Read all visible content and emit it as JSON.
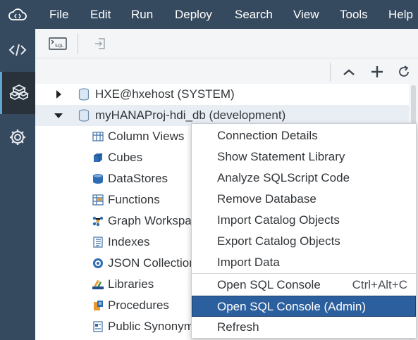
{
  "menubar": {
    "items": [
      {
        "label": "File"
      },
      {
        "label": "Edit"
      },
      {
        "label": "Run"
      },
      {
        "label": "Deploy"
      },
      {
        "label": "Search"
      },
      {
        "label": "View"
      },
      {
        "label": "Tools"
      },
      {
        "label": "Help"
      }
    ]
  },
  "toolbar": {
    "sql_button_glyph": "SQL"
  },
  "tree": {
    "nodes": [
      {
        "label": "HXE@hxehost (SYSTEM)",
        "icon": "database-icon",
        "expanded": false
      },
      {
        "label": "myHANAProj-hdi_db (development)",
        "icon": "database-icon",
        "expanded": true
      },
      {
        "label": "Column Views",
        "icon": "column-view-icon"
      },
      {
        "label": "Cubes",
        "icon": "cube-icon"
      },
      {
        "label": "DataStores",
        "icon": "datastore-icon"
      },
      {
        "label": "Functions",
        "icon": "function-icon"
      },
      {
        "label": "Graph Workspaces",
        "icon": "graph-icon"
      },
      {
        "label": "Indexes",
        "icon": "index-icon"
      },
      {
        "label": "JSON Collections",
        "icon": "json-icon"
      },
      {
        "label": "Libraries",
        "icon": "library-icon"
      },
      {
        "label": "Procedures",
        "icon": "procedure-icon"
      },
      {
        "label": "Public Synonyms",
        "icon": "synonym-icon"
      }
    ]
  },
  "context_menu": {
    "items": [
      {
        "label": "Connection Details"
      },
      {
        "label": "Show Statement Library"
      },
      {
        "label": "Analyze SQLScript Code"
      },
      {
        "label": "Remove Database"
      },
      {
        "label": "Import Catalog Objects"
      },
      {
        "label": "Export Catalog Objects"
      },
      {
        "label": "Import Data"
      },
      {
        "label": "Open SQL Console",
        "shortcut": "Ctrl+Alt+C"
      },
      {
        "label": "Open SQL Console (Admin)",
        "highlighted": true
      },
      {
        "label": "Refresh"
      }
    ]
  },
  "colors": {
    "shell": "#354a5f",
    "highlight": "#2c5f9e",
    "accent": "#5fa6d3"
  }
}
